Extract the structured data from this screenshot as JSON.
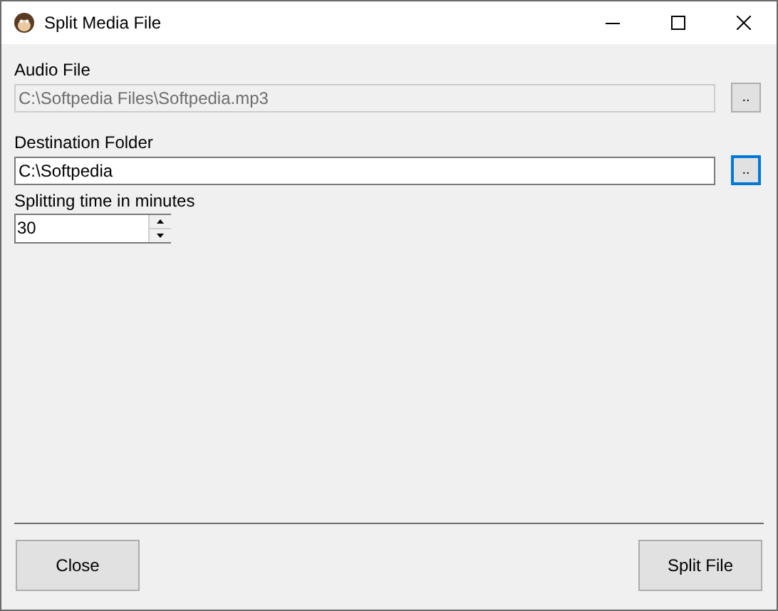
{
  "window": {
    "title": "Split Media File"
  },
  "fields": [
    {
      "label": "Audio File",
      "value": "C:\\Softpedia Files\\Softpedia.mp3",
      "disabled": true,
      "browse": {
        "label": "..",
        "focused": false
      }
    },
    {
      "label": "Destination Folder",
      "value": "C:\\Softpedia",
      "disabled": false,
      "browse": {
        "label": "..",
        "focused": true
      }
    }
  ],
  "splitting": {
    "label": "Splitting time in minutes",
    "value": "30"
  },
  "buttons": [
    "Close",
    "Split File"
  ]
}
